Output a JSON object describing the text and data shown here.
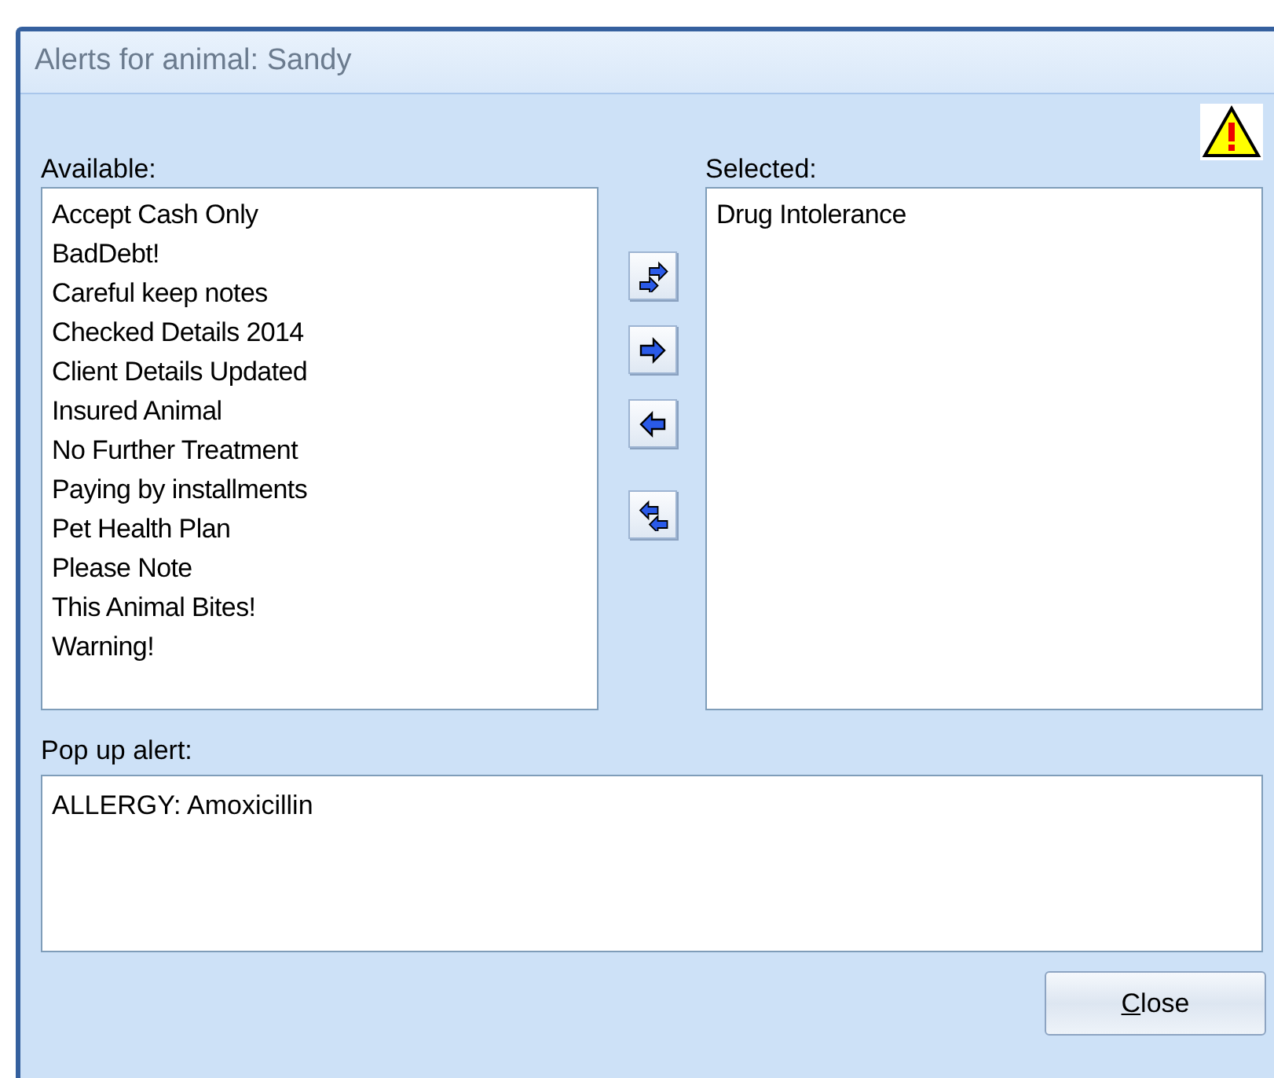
{
  "window": {
    "title": "Alerts for animal: Sandy"
  },
  "available": {
    "label": "Available:",
    "items": [
      "Accept Cash Only",
      "BadDebt!",
      "Careful keep notes",
      "Checked Details 2014",
      "Client Details Updated",
      "Insured Animal",
      "No Further Treatment",
      "Paying by installments",
      "Pet Health Plan",
      "Please Note",
      "This Animal Bites!",
      "Warning!"
    ]
  },
  "transfer_buttons": [
    {
      "kind": "add_all"
    },
    {
      "kind": "add"
    },
    {
      "kind": "remove"
    },
    {
      "kind": "remove_all"
    }
  ],
  "selected": {
    "label": "Selected:",
    "items": [
      "Drug Intolerance"
    ]
  },
  "popup_alert": {
    "label": "Pop up alert:",
    "value": "ALLERGY: Amoxicillin"
  },
  "buttons": [
    "Close"
  ]
}
